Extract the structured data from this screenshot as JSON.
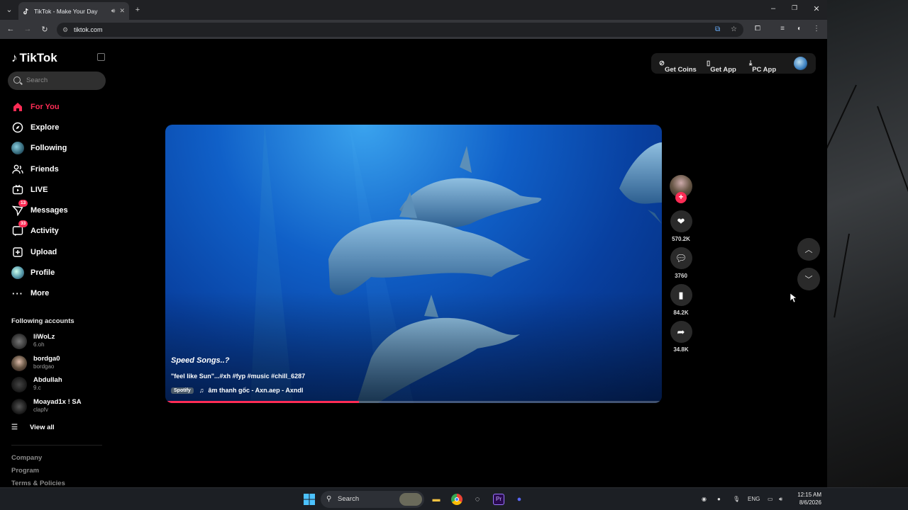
{
  "browser": {
    "tab_title": "TikTok - Make Your Day",
    "url": "tiktok.com",
    "new_tab": "+",
    "minimize": "–",
    "restore": "❐",
    "close": "✕"
  },
  "tiktok": {
    "brand": "TikTok",
    "search_placeholder": "Search",
    "nav": [
      {
        "label": "For You",
        "icon": "home-icon",
        "active": true
      },
      {
        "label": "Explore",
        "icon": "compass-icon"
      },
      {
        "label": "Following",
        "icon": "following-icon"
      },
      {
        "label": "Friends",
        "icon": "friends-icon"
      },
      {
        "label": "LIVE",
        "icon": "live-icon"
      },
      {
        "label": "Messages",
        "icon": "messages-icon",
        "badge": "13"
      },
      {
        "label": "Activity",
        "icon": "activity-icon",
        "badge": "33"
      },
      {
        "label": "Upload",
        "icon": "upload-icon"
      },
      {
        "label": "Profile",
        "icon": "profile-icon"
      },
      {
        "label": "More",
        "icon": "more-icon"
      }
    ],
    "following_title": "Following accounts",
    "accounts": [
      {
        "name": "liWoLz",
        "handle": "6.oh"
      },
      {
        "name": "bordga0",
        "handle": "bordgao"
      },
      {
        "name": "Abdullah",
        "handle": "9.c"
      },
      {
        "name": "Moayad1x ! SA",
        "handle": "clapfv"
      }
    ],
    "view_all": "View all",
    "footer": [
      "Company",
      "Program",
      "Terms & Policies"
    ],
    "top_actions": {
      "coins": "Get Coins",
      "app": "Get App",
      "pc": "PC App"
    },
    "video": {
      "title": "Speed Songs..?",
      "description": "\"feel like Sun\"...#xh #fyp #music #chill_6287",
      "spotify": "Spotify",
      "music": "âm thanh gốc - Axn.aep - Axndl",
      "progress": 0.39
    },
    "stats": {
      "likes": "570.2K",
      "comments": "3760",
      "saves": "84.2K",
      "shares": "34.8K"
    }
  },
  "taskbar": {
    "search": "Search",
    "lang": "ENG",
    "time": "12:15 AM",
    "date": "8/6/2026"
  }
}
